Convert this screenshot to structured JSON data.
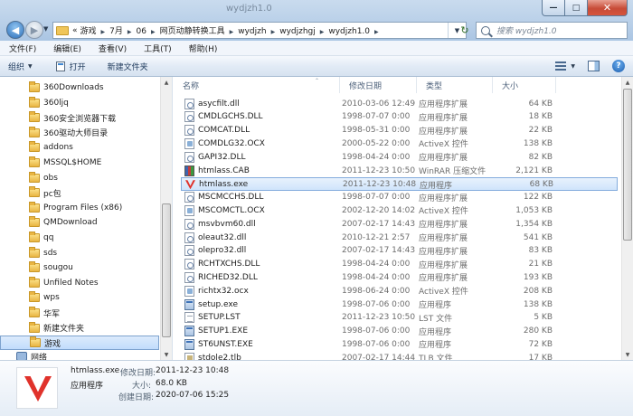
{
  "window": {
    "title": "wydjzh1.0"
  },
  "address": {
    "ellipsis": "«",
    "crumbs": [
      "游戏",
      "7月",
      "06",
      "网页动静转换工具",
      "wydjzh",
      "wydjzhgj",
      "wydjzh1.0"
    ]
  },
  "search": {
    "placeholder": "搜索 wydjzh1.0"
  },
  "menu": [
    "文件(F)",
    "编辑(E)",
    "查看(V)",
    "工具(T)",
    "帮助(H)"
  ],
  "toolbar": {
    "organize": "组织",
    "open": "打开",
    "new_folder": "新建文件夹"
  },
  "nav": {
    "items": [
      "360Downloads",
      "360ljq",
      "360安全浏览器下载",
      "360驱动大师目录",
      "addons",
      "MSSQL$HOME",
      "obs",
      "pc包",
      "Program Files (x86)",
      "QMDownload",
      "qq",
      "sds",
      "sougou",
      "Unfiled Notes",
      "wps",
      "华军",
      "新建文件夹",
      "游戏"
    ],
    "selected_index": 17,
    "network": "网络"
  },
  "columns": {
    "name": "名称",
    "date": "修改日期",
    "type": "类型",
    "size": "大小"
  },
  "files": [
    {
      "name": "asycfilt.dll",
      "date": "2010-03-06 12:49",
      "type": "应用程序扩展",
      "size": "64 KB",
      "icon": "dll"
    },
    {
      "name": "CMDLGCHS.DLL",
      "date": "1998-07-07 0:00",
      "type": "应用程序扩展",
      "size": "18 KB",
      "icon": "dll"
    },
    {
      "name": "COMCAT.DLL",
      "date": "1998-05-31 0:00",
      "type": "应用程序扩展",
      "size": "22 KB",
      "icon": "dll"
    },
    {
      "name": "COMDLG32.OCX",
      "date": "2000-05-22 0:00",
      "type": "ActiveX 控件",
      "size": "138 KB",
      "icon": "ocx"
    },
    {
      "name": "GAPI32.DLL",
      "date": "1998-04-24 0:00",
      "type": "应用程序扩展",
      "size": "82 KB",
      "icon": "dll"
    },
    {
      "name": "htmlass.CAB",
      "date": "2011-12-23 10:50",
      "type": "WinRAR 压缩文件",
      "size": "2,121 KB",
      "icon": "cab"
    },
    {
      "name": "htmlass.exe",
      "date": "2011-12-23 10:48",
      "type": "应用程序",
      "size": "68 KB",
      "icon": "app"
    },
    {
      "name": "MSCMCCHS.DLL",
      "date": "1998-07-07 0:00",
      "type": "应用程序扩展",
      "size": "122 KB",
      "icon": "dll"
    },
    {
      "name": "MSCOMCTL.OCX",
      "date": "2002-12-20 14:02",
      "type": "ActiveX 控件",
      "size": "1,053 KB",
      "icon": "ocx"
    },
    {
      "name": "msvbvm60.dll",
      "date": "2007-02-17 14:43",
      "type": "应用程序扩展",
      "size": "1,354 KB",
      "icon": "dll"
    },
    {
      "name": "oleaut32.dll",
      "date": "2010-12-21 2:57",
      "type": "应用程序扩展",
      "size": "541 KB",
      "icon": "dll"
    },
    {
      "name": "olepro32.dll",
      "date": "2007-02-17 14:43",
      "type": "应用程序扩展",
      "size": "83 KB",
      "icon": "dll"
    },
    {
      "name": "RCHTXCHS.DLL",
      "date": "1998-04-24 0:00",
      "type": "应用程序扩展",
      "size": "21 KB",
      "icon": "dll"
    },
    {
      "name": "RICHED32.DLL",
      "date": "1998-04-24 0:00",
      "type": "应用程序扩展",
      "size": "193 KB",
      "icon": "dll"
    },
    {
      "name": "richtx32.ocx",
      "date": "1998-06-24 0:00",
      "type": "ActiveX 控件",
      "size": "208 KB",
      "icon": "ocx"
    },
    {
      "name": "setup.exe",
      "date": "1998-07-06 0:00",
      "type": "应用程序",
      "size": "138 KB",
      "icon": "exe"
    },
    {
      "name": "SETUP.LST",
      "date": "2011-12-23 10:50",
      "type": "LST 文件",
      "size": "5 KB",
      "icon": "txt"
    },
    {
      "name": "SETUP1.EXE",
      "date": "1998-07-06 0:00",
      "type": "应用程序",
      "size": "280 KB",
      "icon": "exe"
    },
    {
      "name": "ST6UNST.EXE",
      "date": "1998-07-06 0:00",
      "type": "应用程序",
      "size": "72 KB",
      "icon": "exe"
    },
    {
      "name": "stdole2.tlb",
      "date": "2007-02-17 14:44",
      "type": "TLB 文件",
      "size": "17 KB",
      "icon": "tlb"
    }
  ],
  "selected_file_index": 6,
  "details": {
    "name": "htmlass.exe",
    "type": "应用程序",
    "modified_label": "修改日期:",
    "modified": "2011-12-23 10:48",
    "size_label": "大小:",
    "size": "68.0 KB",
    "created_label": "创建日期:",
    "created": "2020-07-06 15:25"
  }
}
